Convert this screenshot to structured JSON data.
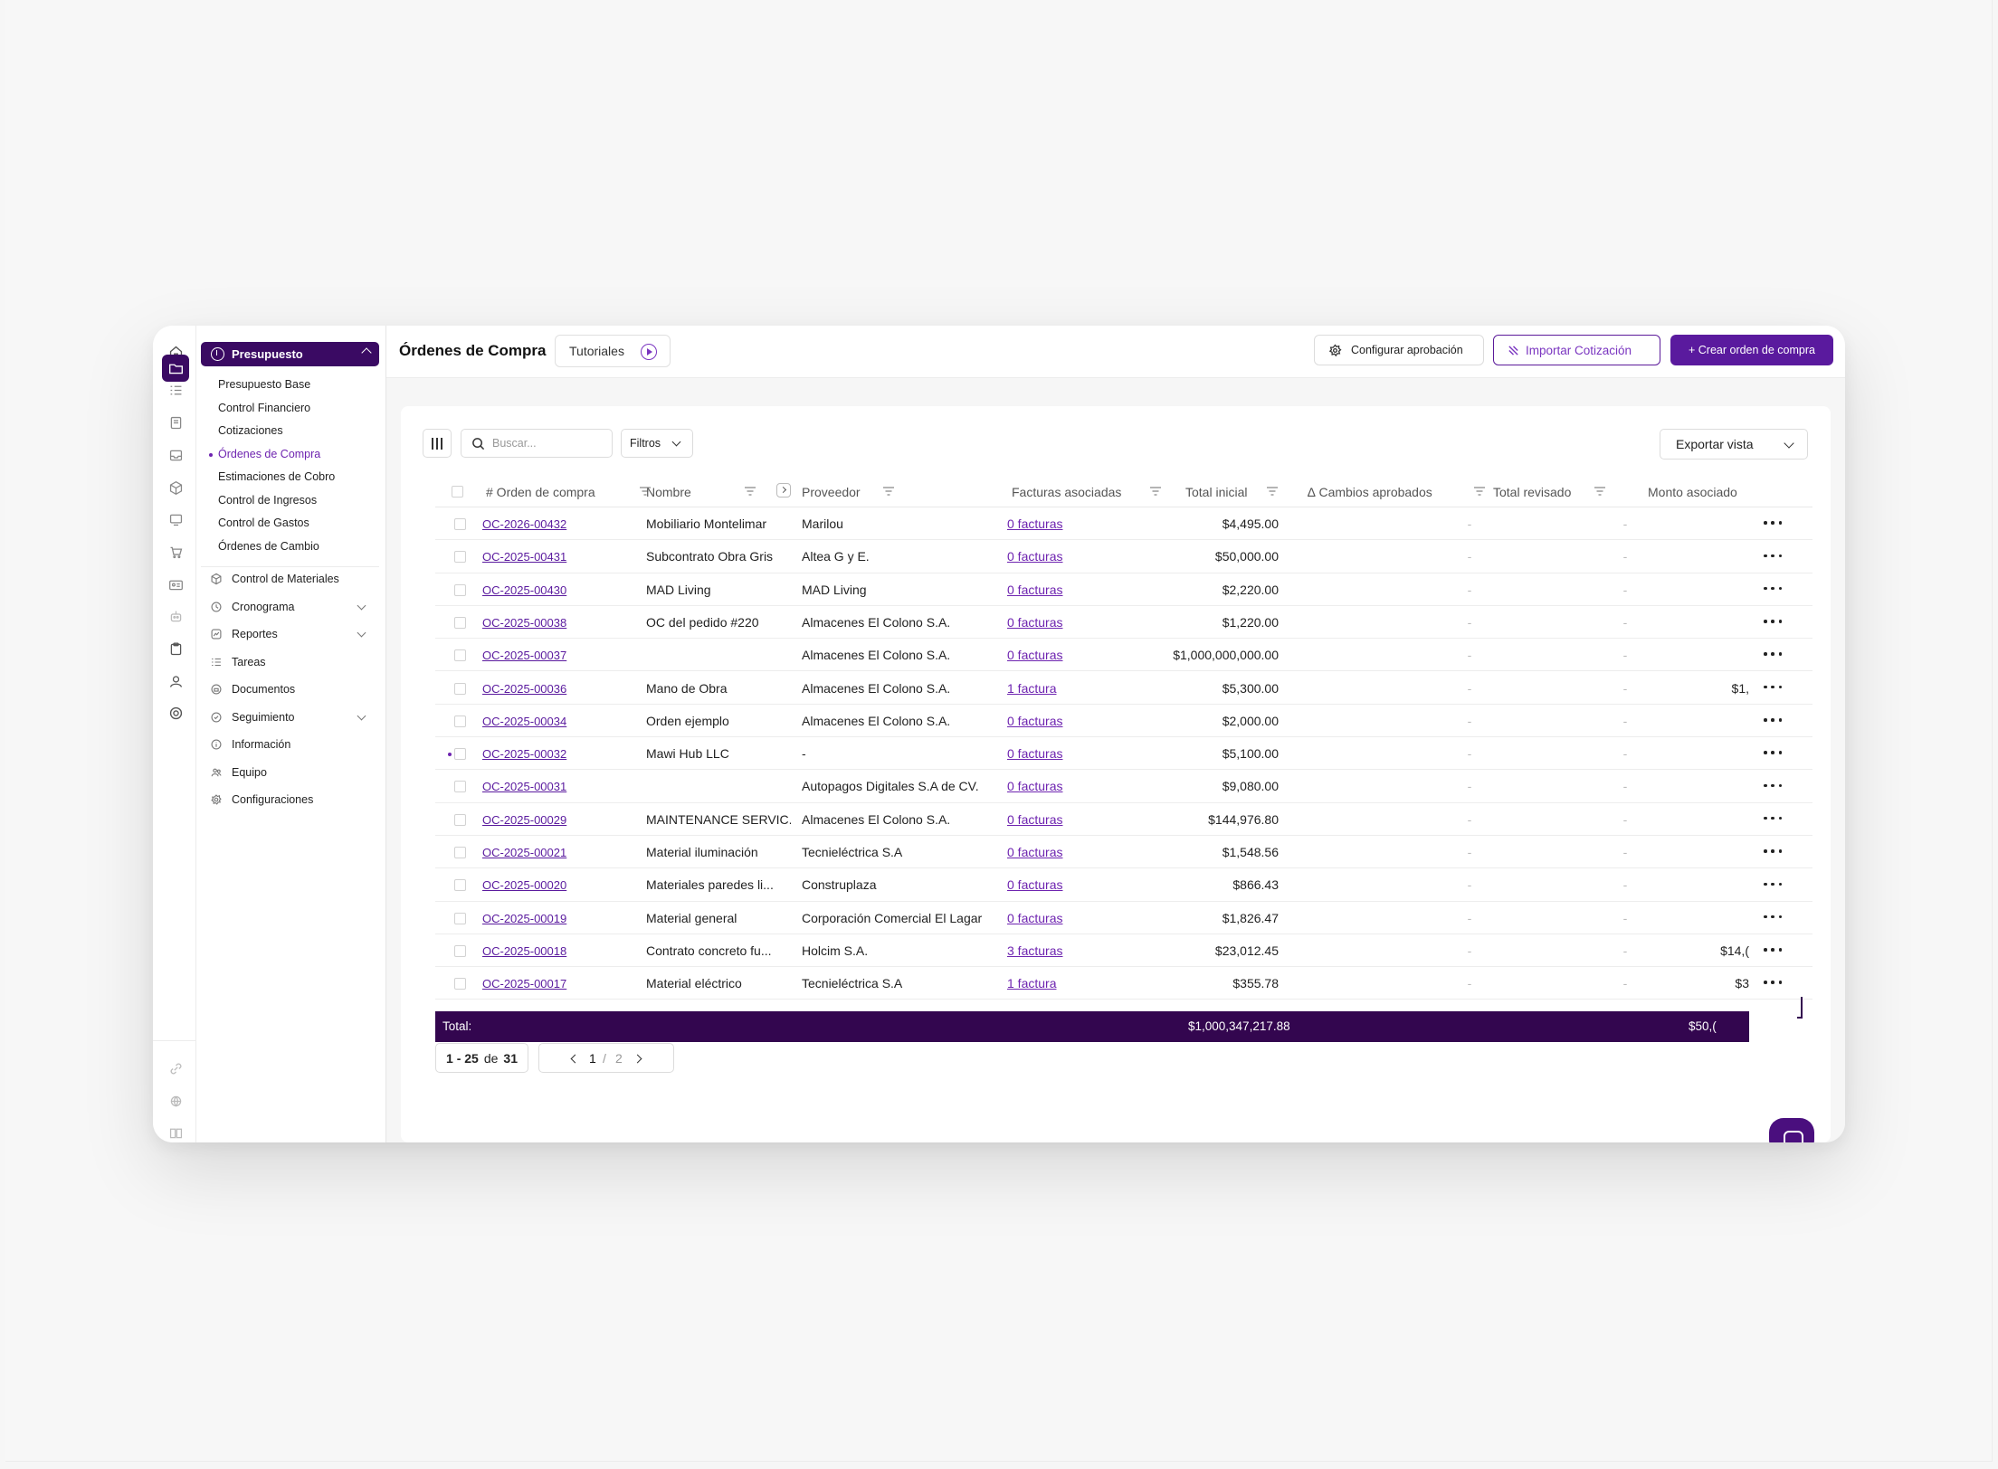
{
  "sidebar": {
    "section_title": "Presupuesto",
    "sub_items": [
      {
        "label": "Presupuesto Base"
      },
      {
        "label": "Control Financiero"
      },
      {
        "label": "Cotizaciones"
      },
      {
        "label": "Órdenes de Compra"
      },
      {
        "label": "Estimaciones de Cobro"
      },
      {
        "label": "Control de Ingresos"
      },
      {
        "label": "Control de Gastos"
      },
      {
        "label": "Órdenes de Cambio"
      }
    ],
    "active_sub_item": "Órdenes de Compra",
    "menu_items": [
      {
        "label": "Control de Materiales",
        "icon": "cube-icon"
      },
      {
        "label": "Cronograma",
        "icon": "clock-icon",
        "expandable": true
      },
      {
        "label": "Reportes",
        "icon": "chart-icon",
        "expandable": true
      },
      {
        "label": "Tareas",
        "icon": "list-icon"
      },
      {
        "label": "Documentos",
        "icon": "folder-icon"
      },
      {
        "label": "Seguimiento",
        "icon": "check-circle-icon",
        "expandable": true
      },
      {
        "label": "Información",
        "icon": "info-icon"
      },
      {
        "label": "Equipo",
        "icon": "users-icon"
      },
      {
        "label": "Configuraciones",
        "icon": "gear-icon"
      }
    ]
  },
  "header": {
    "title": "Órdenes de Compra",
    "tutorials_label": "Tutoriales",
    "configure_label": "Configurar aprobación",
    "import_label": "Importar Cotización",
    "create_label": "+ Crear orden de compra"
  },
  "toolbar": {
    "search_placeholder": "Buscar...",
    "filters_label": "Filtros",
    "export_label": "Exportar vista"
  },
  "table": {
    "columns": [
      "# Orden de compra",
      "Nombre",
      "Proveedor",
      "Facturas asociadas",
      "Total inicial",
      "∆ Cambios aprobados",
      "Total revisado",
      "Monto asociado"
    ],
    "rows": [
      {
        "id": "OC-2026-00432",
        "name": "Mobiliario Montelimar",
        "provider": "Marilou",
        "invoices": "0 facturas",
        "total": "$4,495.00",
        "changes": "-",
        "revised": "-",
        "amount": ""
      },
      {
        "id": "OC-2025-00431",
        "name": "Subcontrato Obra Gris",
        "provider": "Altea G y E.",
        "invoices": "0 facturas",
        "total": "$50,000.00",
        "changes": "-",
        "revised": "-",
        "amount": ""
      },
      {
        "id": "OC-2025-00430",
        "name": "MAD Living",
        "provider": "MAD Living",
        "invoices": "0 facturas",
        "total": "$2,220.00",
        "changes": "-",
        "revised": "-",
        "amount": ""
      },
      {
        "id": "OC-2025-00038",
        "name": "OC del pedido #220",
        "provider": "Almacenes El Colono S.A.",
        "invoices": "0 facturas",
        "total": "$1,220.00",
        "changes": "-",
        "revised": "-",
        "amount": ""
      },
      {
        "id": "OC-2025-00037",
        "name": "",
        "provider": "Almacenes El Colono S.A.",
        "invoices": "0 facturas",
        "total": "$1,000,000,000.00",
        "changes": "-",
        "revised": "-",
        "amount": ""
      },
      {
        "id": "OC-2025-00036",
        "name": "Mano de Obra",
        "provider": "Almacenes El Colono S.A.",
        "invoices": "1 factura",
        "total": "$5,300.00",
        "changes": "-",
        "revised": "-",
        "amount": "$1,"
      },
      {
        "id": "OC-2025-00034",
        "name": "Orden ejemplo",
        "provider": "Almacenes El Colono S.A.",
        "invoices": "0 facturas",
        "total": "$2,000.00",
        "changes": "-",
        "revised": "-",
        "amount": ""
      },
      {
        "id": "OC-2025-00032",
        "name": "Mawi Hub LLC",
        "provider": "-",
        "invoices": "0 facturas",
        "total": "$5,100.00",
        "changes": "-",
        "revised": "-",
        "amount": ""
      },
      {
        "id": "OC-2025-00031",
        "name": "",
        "provider": "Autopagos Digitales S.A de CV.",
        "invoices": "0 facturas",
        "total": "$9,080.00",
        "changes": "-",
        "revised": "-",
        "amount": ""
      },
      {
        "id": "OC-2025-00029",
        "name": "MAINTENANCE SERVIC...",
        "provider": "Almacenes El Colono S.A.",
        "invoices": "0 facturas",
        "total": "$144,976.80",
        "changes": "-",
        "revised": "-",
        "amount": ""
      },
      {
        "id": "OC-2025-00021",
        "name": "Material iluminación",
        "provider": "Tecnieléctrica S.A",
        "invoices": "0 facturas",
        "total": "$1,548.56",
        "changes": "-",
        "revised": "-",
        "amount": ""
      },
      {
        "id": "OC-2025-00020",
        "name": "Materiales paredes li...",
        "provider": "Construplaza",
        "invoices": "0 facturas",
        "total": "$866.43",
        "changes": "-",
        "revised": "-",
        "amount": ""
      },
      {
        "id": "OC-2025-00019",
        "name": "Material general",
        "provider": "Corporación Comercial El Lagar",
        "invoices": "0 facturas",
        "total": "$1,826.47",
        "changes": "-",
        "revised": "-",
        "amount": ""
      },
      {
        "id": "OC-2025-00018",
        "name": "Contrato concreto fu...",
        "provider": "Holcim S.A.",
        "invoices": "3 facturas",
        "total": "$23,012.45",
        "changes": "-",
        "revised": "-",
        "amount": "$14,("
      },
      {
        "id": "OC-2025-00017",
        "name": "Material eléctrico",
        "provider": "Tecnieléctrica S.A",
        "invoices": "1 factura",
        "total": "$355.78",
        "changes": "-",
        "revised": "-",
        "amount": "$3"
      }
    ],
    "total_label": "Total:",
    "total_value": "$1,000,347,217.88",
    "total_amount": "$50,("
  },
  "pagination": {
    "range": "1 - 25",
    "of_label": "de",
    "total": "31",
    "current_page": "1",
    "separator": "/",
    "total_pages": "2"
  },
  "colors": {
    "brand": "#3a0a63",
    "accent": "#5a1a9e",
    "link": "#6e24b0"
  }
}
